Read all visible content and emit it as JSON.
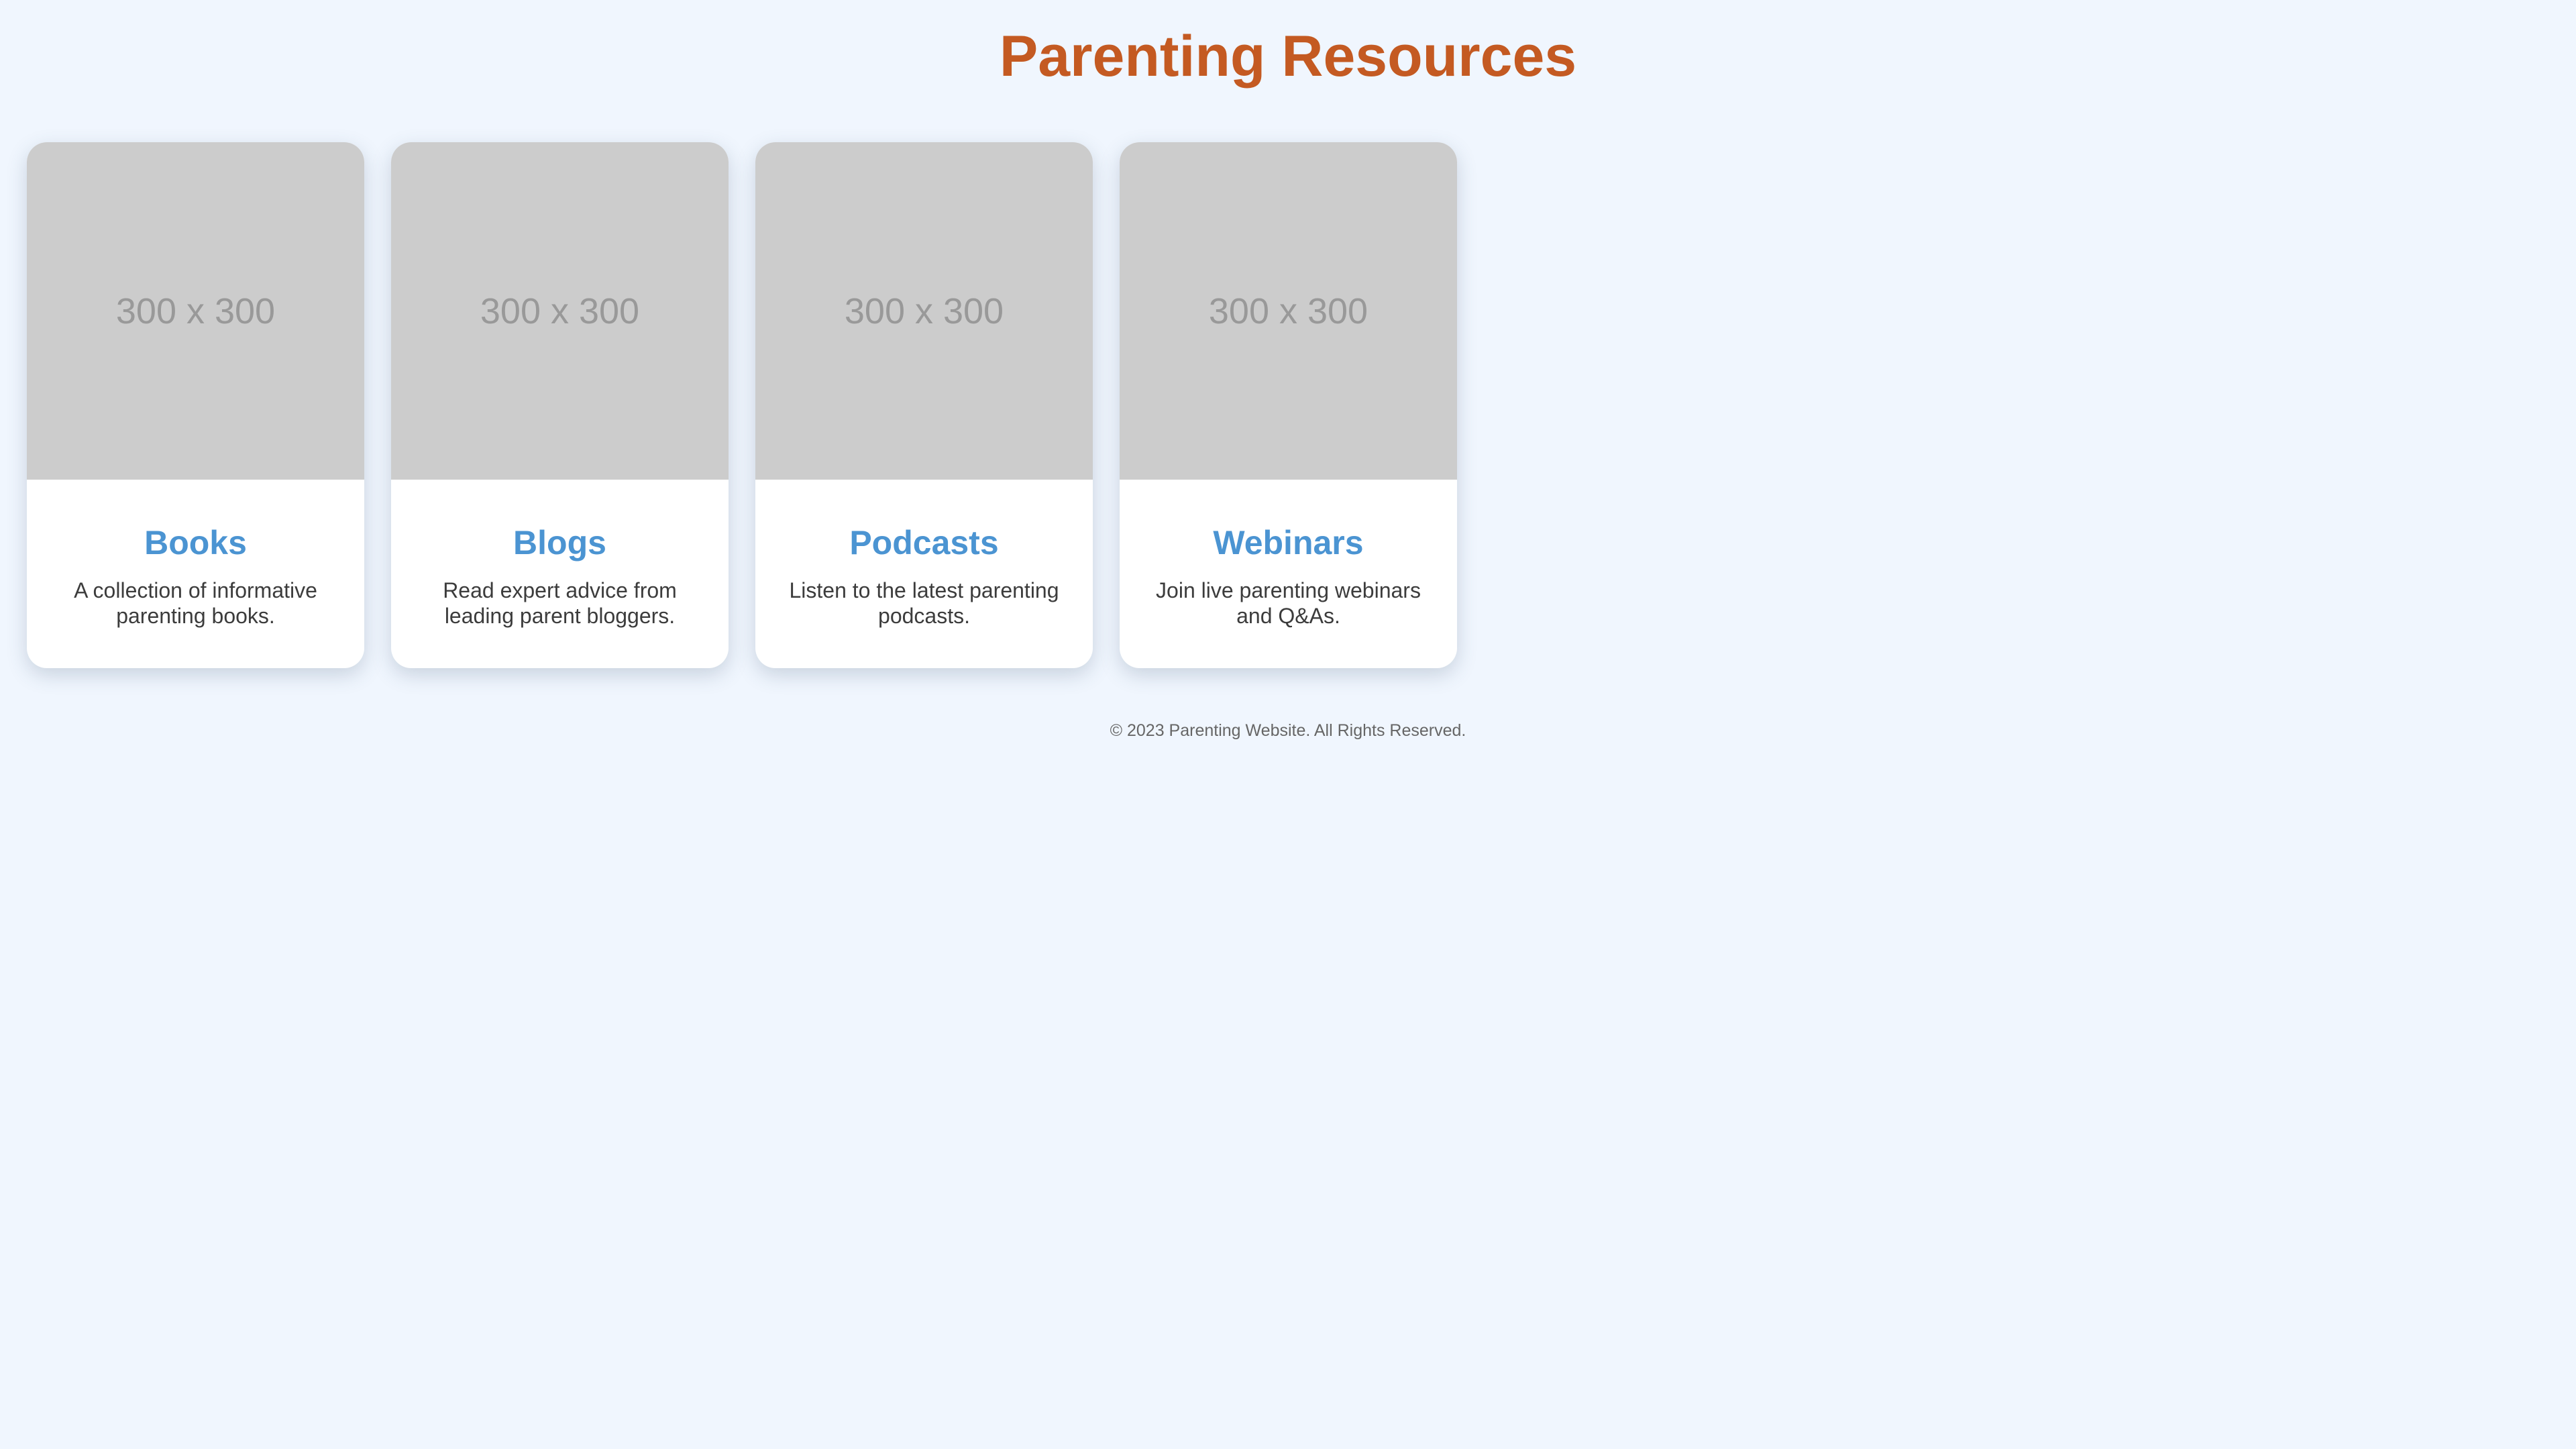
{
  "page": {
    "title": "Parenting Resources",
    "accent_color": "#c45a22",
    "card_title_color": "#4b94d2",
    "background_color": "#f0f6fe"
  },
  "cards": [
    {
      "image_placeholder": "300 x 300",
      "title": "Books",
      "description": "A collection of informative parenting books."
    },
    {
      "image_placeholder": "300 x 300",
      "title": "Blogs",
      "description": "Read expert advice from leading parent bloggers."
    },
    {
      "image_placeholder": "300 x 300",
      "title": "Podcasts",
      "description": "Listen to the latest parenting podcasts."
    },
    {
      "image_placeholder": "300 x 300",
      "title": "Webinars",
      "description": "Join live parenting webinars and Q&As."
    }
  ],
  "footer": {
    "text": "© 2023 Parenting Website. All Rights Reserved."
  }
}
